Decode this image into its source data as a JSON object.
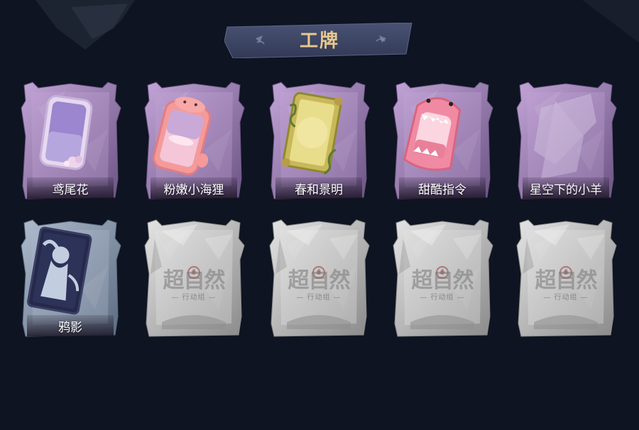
{
  "header": {
    "title": "工牌"
  },
  "colors": {
    "background": "#0e1421",
    "banner": "#3d4563",
    "title": "#e9c88a",
    "frame_purple": "#9d80b5",
    "frame_blue": "#8798ad",
    "frame_locked": "#bdbdbd"
  },
  "badges": [
    {
      "name": "鸢尾花",
      "theme": "purple",
      "art": "iris-frame-icon",
      "locked": false
    },
    {
      "name": "粉嫩小海狸",
      "theme": "purple",
      "art": "pink-beaver-frame-icon",
      "locked": false
    },
    {
      "name": "春和景明",
      "theme": "purple",
      "art": "golden-vine-frame-icon",
      "locked": false
    },
    {
      "name": "甜酷指令",
      "theme": "purple",
      "art": "pink-shark-frame-icon",
      "locked": false
    },
    {
      "name": "星空下的小羊",
      "theme": "purple",
      "art": "blank-frame-icon",
      "locked": false
    },
    {
      "name": "鸦影",
      "theme": "blue",
      "art": "silhouette-frame-icon",
      "locked": false
    },
    {
      "name": "",
      "theme": "locked",
      "art": "locked-placeholder-icon",
      "locked": true
    },
    {
      "name": "",
      "theme": "locked",
      "art": "locked-placeholder-icon",
      "locked": true
    },
    {
      "name": "",
      "theme": "locked",
      "art": "locked-placeholder-icon",
      "locked": true
    },
    {
      "name": "",
      "theme": "locked",
      "art": "locked-placeholder-icon",
      "locked": true
    }
  ],
  "locked_watermark": {
    "main": "超自然",
    "sub": "— 行动组 —"
  }
}
